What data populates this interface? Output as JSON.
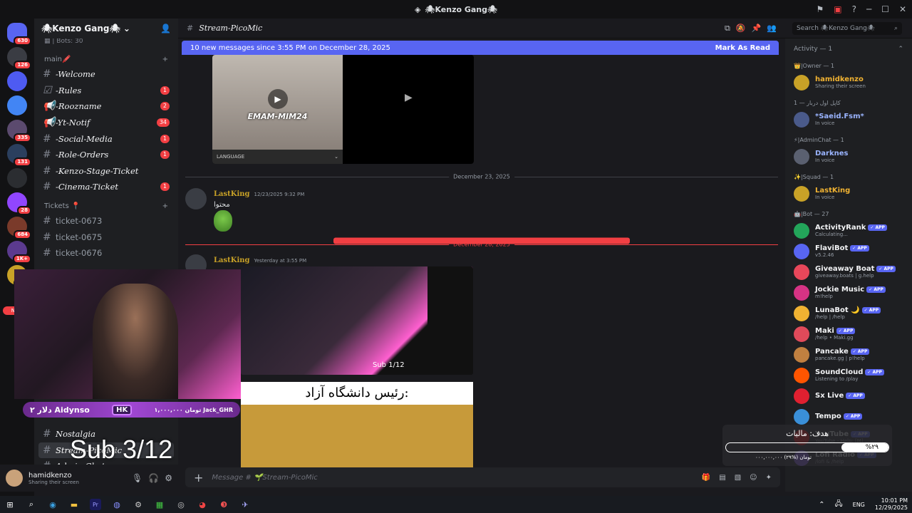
{
  "window": {
    "title": "🕷Kenzo Gang🕷"
  },
  "servers": [
    {
      "badge": "630",
      "color": "#5865f2"
    },
    {
      "badge": "126",
      "color": "#3a3c43"
    },
    {
      "badge": "",
      "color": "#4e5bf2"
    },
    {
      "badge": "",
      "color": "#4285f4"
    },
    {
      "badge": "335",
      "color": "#5b4a6e"
    },
    {
      "badge": "131",
      "color": "#2b3f5e"
    },
    {
      "badge": "",
      "color": "#2b2d31"
    },
    {
      "badge": "28",
      "color": "#9146ff"
    },
    {
      "badge": "684",
      "color": "#7a3a2a"
    },
    {
      "badge": "1K+",
      "color": "#5b3a8e"
    },
    {
      "badge": "136",
      "color": "#c9a227"
    }
  ],
  "guild": {
    "name": "🕷Kenzo Gang🕷",
    "bots_line": "Bots: 30"
  },
  "categories": {
    "main": "main🖍️",
    "tickets": "Tickets 📍"
  },
  "channels": [
    {
      "name": "-Welcome",
      "count": "",
      "type": "text"
    },
    {
      "name": "-Rules",
      "count": "1",
      "type": "rules"
    },
    {
      "name": "-Rooznаme",
      "count": "2",
      "type": "announce"
    },
    {
      "name": "-Yt-Notif",
      "count": "34",
      "type": "announce"
    },
    {
      "name": "-Social-Media",
      "count": "1",
      "type": "text"
    },
    {
      "name": "-Role-Orders",
      "count": "1",
      "type": "text"
    },
    {
      "name": "-Kenzo-Stage-Ticket",
      "count": "",
      "type": "text"
    },
    {
      "name": "-Cinema-Ticket",
      "count": "1",
      "type": "text"
    }
  ],
  "tickets": [
    "ticket-0673",
    "ticket-0675",
    "ticket-0676"
  ],
  "lower_channels": [
    {
      "name": "Nostalgia",
      "count": ""
    },
    {
      "name": "Stream-PicoMic",
      "count": ""
    },
    {
      "name": "Admin-Chat",
      "count": ""
    }
  ],
  "user": {
    "name": "hamidkenzo",
    "status": "Sharing their screen"
  },
  "channel": {
    "name": "Stream-PicoMic"
  },
  "banner": {
    "text": "10 new messages since 3:55 PM on December 28, 2025",
    "action": "Mark As Read"
  },
  "video": {
    "label": "EMAM-MIM24",
    "language": "LANGUAGE"
  },
  "dividers": {
    "d1": "December 23, 2025",
    "d2": "December 28, 2025",
    "new": "NEW"
  },
  "messages": [
    {
      "author": "LastKing",
      "time": "12/23/2025 9:32 PM",
      "text": "محتوا"
    },
    {
      "author": "LastKing",
      "time": "Yesterday at 3:55 PM",
      "text": ""
    }
  ],
  "stream": {
    "sub_small": "Sub 1/12",
    "caption": "رئیس دانشگاه آزاد:"
  },
  "composer": {
    "placeholder": "Message # 🌱Stream-PicoMic"
  },
  "overlay": {
    "donation_left": "۲ دلار Aidynso",
    "donation_right": "۱,۰۰۰,۰۰۰ تومان Jack_GHR",
    "logo": "HK",
    "sub": "Sub 3/12"
  },
  "goal": {
    "title": "هدف: مالیات",
    "percent": "%۲۹",
    "amount": "۰۰۰,۰۰۰,۰۰۰ تومان (%۲۹)"
  },
  "members": {
    "search": "Search 🕷Kenzo Gang🕷",
    "activity": "Activity — 1",
    "groups": [
      {
        "title": "👑|Owner — 1",
        "items": [
          {
            "name": "hamidkenzo",
            "status": "Sharing their screen",
            "app": false,
            "color": "#c9a227"
          }
        ]
      },
      {
        "title": "کاپل اول دربار — 1",
        "items": [
          {
            "name": "*Saeid.Fsm*",
            "status": "In voice",
            "app": false,
            "color": "#4a5a8a"
          }
        ]
      },
      {
        "title": "⚡|AdminChat — 1",
        "items": [
          {
            "name": "Darknes",
            "status": "In voice",
            "app": false,
            "color": "#5a6070"
          }
        ]
      },
      {
        "title": "✨|Squad — 1",
        "items": [
          {
            "name": "LastKing",
            "status": "In voice",
            "app": false,
            "color": "#c9a227"
          }
        ]
      },
      {
        "title": "🤖|Bot — 27",
        "items": [
          {
            "name": "ActivityRank",
            "status": "Calculating...",
            "app": true,
            "color": "#23a55a"
          },
          {
            "name": "FlaviBot",
            "status": "v5.2.46",
            "app": true,
            "color": "#5865f2"
          },
          {
            "name": "Giveaway Boat",
            "status": "giveaway.boats | g.help",
            "app": true,
            "color": "#e8475a"
          },
          {
            "name": "Jockie Music",
            "status": "m!help",
            "app": true,
            "color": "#d63384"
          },
          {
            "name": "LunaBot 🌙",
            "status": "/help | /help",
            "app": true,
            "color": "#f0b232"
          },
          {
            "name": "Maki",
            "status": "/help • Maki.gg",
            "app": true,
            "color": "#e04a5a"
          },
          {
            "name": "Pancake",
            "status": "pancake.gg | p!help",
            "app": true,
            "color": "#c08040"
          },
          {
            "name": "SoundCloud",
            "status": "Listening to /play",
            "app": true,
            "color": "#ff5500"
          },
          {
            "name": "Sx Live",
            "status": "",
            "app": true,
            "color": "#e02030"
          },
          {
            "name": "Tempo",
            "status": "",
            "app": true,
            "color": "#3a8fd8"
          },
          {
            "name": "YouTube",
            "status": "YouTube - Help: [M] ...",
            "app": true,
            "color": "#ff0000"
          },
          {
            "name": "Lofi Radio",
            "status": "/lofi & /help",
            "app": true,
            "color": "#8a5cf6"
          }
        ]
      }
    ]
  },
  "taskbar": {
    "time": "10:01 PM",
    "date": "12/29/2025",
    "lang": "ENG"
  }
}
